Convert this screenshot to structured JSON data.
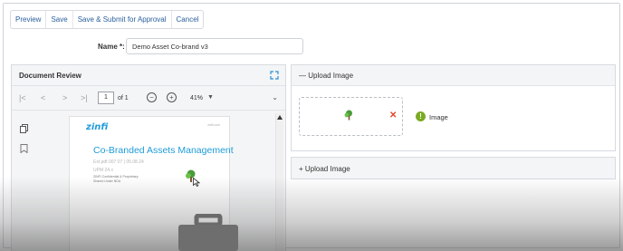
{
  "toolbar": {
    "preview": "Preview",
    "save": "Save",
    "save_submit": "Save & Submit for Approval",
    "cancel": "Cancel"
  },
  "name_field": {
    "label": "Name *:",
    "value": "Demo Asset Co-brand v3"
  },
  "document_review": {
    "title": "Document Review",
    "pdf_toolbar": {
      "current_page": "1",
      "of_pages": "of 1",
      "zoom": "41%"
    },
    "page": {
      "logo_text": "zinfi",
      "corner_text": "zinfi.com",
      "heading": "Co-Branded Assets Management",
      "ext_line": "Ext.pdf.007 07 | 05.08.24",
      "upm_line": "UPM 24.x",
      "confidential_1": "ZINFI Confidential & Proprietary",
      "confidential_2": "Shared Under NDA"
    }
  },
  "upload_panels": [
    {
      "label": "Upload Image",
      "expanded": true,
      "status_text": "Image"
    },
    {
      "label": "Upload Image",
      "expanded": false
    }
  ],
  "colors": {
    "link": "#2a5f9e",
    "brand_blue": "#1f9bd7",
    "remove_red": "#e0472b",
    "status_green": "#7aaa22"
  }
}
